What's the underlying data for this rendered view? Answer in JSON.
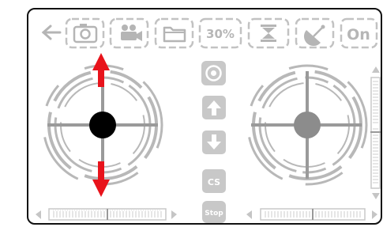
{
  "toolbar": {
    "back_icon": "arrow-left-icon",
    "camera_icon": "camera-icon",
    "video_icon": "video-camera-icon",
    "folder_icon": "folder-icon",
    "speed_label": "30%",
    "hourglass_icon": "hourglass-icon",
    "satellite_icon": "satellite-dish-icon",
    "power_label": "On"
  },
  "center_buttons": {
    "headless_icon": "headless-mode-icon",
    "up_icon": "arrow-up-icon",
    "down_icon": "arrow-down-icon",
    "calibrate_label": "CS",
    "stop_label": "Stop"
  },
  "left_joystick": {
    "knob_state": "active",
    "arrows": [
      "up",
      "down"
    ]
  },
  "right_joystick": {
    "knob_state": "idle"
  },
  "colors": {
    "control_gray": "#b5b5b5",
    "crosshair_gray": "#9a9a9a",
    "arrow_red": "#e8131b",
    "knob_active": "#000000",
    "knob_idle": "#8c8c8c",
    "border": "#111111"
  }
}
